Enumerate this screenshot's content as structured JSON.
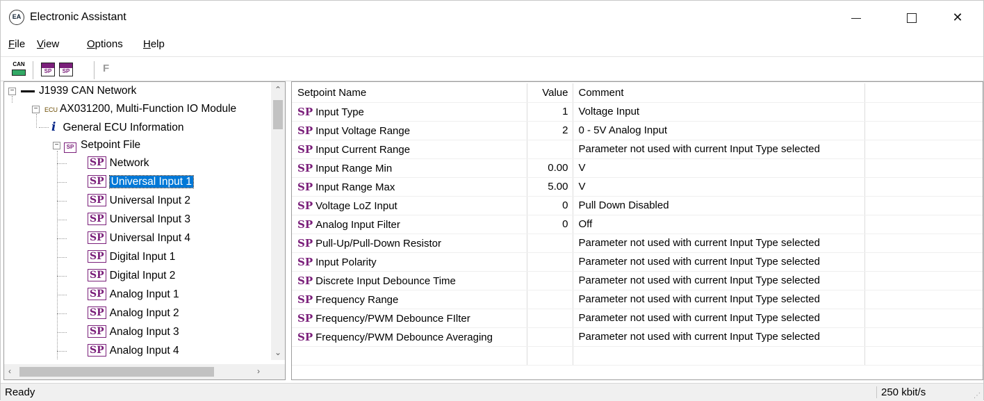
{
  "window": {
    "title": "Electronic Assistant",
    "app_icon_text": "EA"
  },
  "menu": [
    {
      "label": "File",
      "accel": "F",
      "rest": "ile"
    },
    {
      "label": "View",
      "accel": "V",
      "rest": "iew"
    },
    {
      "label": "Options",
      "accel": "O",
      "rest": "ptions"
    },
    {
      "label": "Help",
      "accel": "H",
      "rest": "elp"
    }
  ],
  "toolbar": {
    "can_label": "CAN",
    "sp_label": "SP",
    "f_label": "F"
  },
  "tree": {
    "root": "J1939 CAN Network",
    "ecu_tag": "ECU",
    "ecu": "AX031200, Multi-Function IO Module",
    "info": "General ECU Information",
    "setpoint_file": "Setpoint File",
    "items": [
      "Network",
      "Universal Input 1",
      "Universal Input 2",
      "Universal Input 3",
      "Universal Input 4",
      "Digital Input 1",
      "Digital Input 2",
      "Analog Input 1",
      "Analog Input 2",
      "Analog Input 3",
      "Analog Input 4"
    ],
    "selected_index": 1,
    "sp_icon_text": "SP"
  },
  "grid": {
    "headers": {
      "name": "Setpoint Name",
      "value": "Value",
      "comment": "Comment"
    },
    "sp_tag": "SP",
    "rows": [
      {
        "name": "Input Type",
        "value": "1",
        "comment": "Voltage Input"
      },
      {
        "name": "Input Voltage Range",
        "value": "2",
        "comment": "0 - 5V Analog Input"
      },
      {
        "name": "Input Current Range",
        "value": "",
        "comment": "Parameter not used with current Input Type selected"
      },
      {
        "name": "Input Range Min",
        "value": "0.00",
        "comment": "V"
      },
      {
        "name": "Input Range Max",
        "value": "5.00",
        "comment": "V"
      },
      {
        "name": "Voltage LoZ Input",
        "value": "0",
        "comment": "Pull Down Disabled"
      },
      {
        "name": "Analog Input Filter",
        "value": "0",
        "comment": "Off"
      },
      {
        "name": "Pull-Up/Pull-Down Resistor",
        "value": "",
        "comment": "Parameter not used with current Input Type selected"
      },
      {
        "name": "Input Polarity",
        "value": "",
        "comment": "Parameter not used with current Input Type selected"
      },
      {
        "name": "Discrete Input Debounce Time",
        "value": "",
        "comment": "Parameter not used with current Input Type selected"
      },
      {
        "name": "Frequency Range",
        "value": "",
        "comment": "Parameter not used with current Input Type selected"
      },
      {
        "name": "Frequency/PWM Debounce FIlter",
        "value": "",
        "comment": "Parameter not used with current Input Type selected"
      },
      {
        "name": "Frequency/PWM Debounce Averaging",
        "value": "",
        "comment": "Parameter not used with current Input Type selected"
      }
    ]
  },
  "status": {
    "left": "Ready",
    "right": "250 kbit/s"
  },
  "colors": {
    "selection": "#0078d7",
    "sp_purple": "#7a1f7a"
  }
}
